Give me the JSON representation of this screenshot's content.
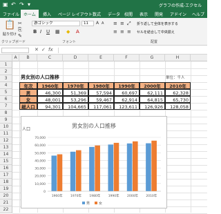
{
  "app": {
    "doc_title": "グラフの作成-エクセル"
  },
  "ribbon": {
    "tabs": [
      "ファイル",
      "ホーム",
      "挿入",
      "ページ レイアウト",
      "数式",
      "データ",
      "校閲",
      "表示",
      "開発",
      "アドイン",
      "ヘルプ"
    ],
    "active_tab": "ホーム",
    "font_name": "游ゴシック",
    "font_size": "11",
    "paste_label": "貼り付け",
    "clipboard_label": "クリップボード",
    "font_label": "フォント",
    "align_label": "配置",
    "wrap_label": "折り返して全体を表示する",
    "merge_label": "セルを結合して中央揃え"
  },
  "sheet": {
    "columns": [
      "A",
      "B",
      "C",
      "D",
      "E",
      "F",
      "G",
      "H"
    ],
    "rows": [
      "1",
      "2",
      "3",
      "4",
      "5",
      "6",
      "7",
      "8",
      "9",
      "10",
      "11",
      "12",
      "13",
      "14",
      "15",
      "16",
      "17",
      "18",
      "19",
      "20",
      "21",
      "22"
    ],
    "title": "男女別の人口推移",
    "unit": "単位：千人",
    "header": [
      "年次",
      "1960年",
      "1970年",
      "1980年",
      "1990年",
      "2000年",
      "2010年"
    ],
    "data_rows": [
      {
        "label": "男",
        "values": [
          "46,300",
          "51,369",
          "57,594",
          "60,697",
          "62,111",
          "62,328"
        ]
      },
      {
        "label": "女",
        "values": [
          "48,001",
          "53,296",
          "59,467",
          "62,914",
          "64,815",
          "65,730"
        ]
      },
      {
        "label": "総人口",
        "values": [
          "94,301",
          "104,665",
          "117,061",
          "123,611",
          "126,926",
          "128,058"
        ]
      }
    ]
  },
  "chart_data": {
    "type": "bar",
    "title": "男女別の人口推移",
    "ylabel": "人口",
    "categories": [
      "1960年",
      "1970年",
      "1980年",
      "1990年",
      "2000年",
      "2010年"
    ],
    "series": [
      {
        "name": "男",
        "values": [
          46300,
          51369,
          57594,
          60697,
          62111,
          62328
        ],
        "color": "#5b9bd5"
      },
      {
        "name": "女",
        "values": [
          48001,
          53296,
          59467,
          62914,
          64815,
          65730
        ],
        "color": "#ed7d31"
      }
    ],
    "ylim": [
      0,
      70000
    ],
    "yticks": [
      "0",
      "10,000",
      "20,000",
      "30,000",
      "40,000",
      "50,000",
      "60,000",
      "70,000"
    ],
    "legend": "bottom",
    "grid": true
  },
  "colors": {
    "brand": "#217346",
    "header_fill": "#f4b183"
  }
}
